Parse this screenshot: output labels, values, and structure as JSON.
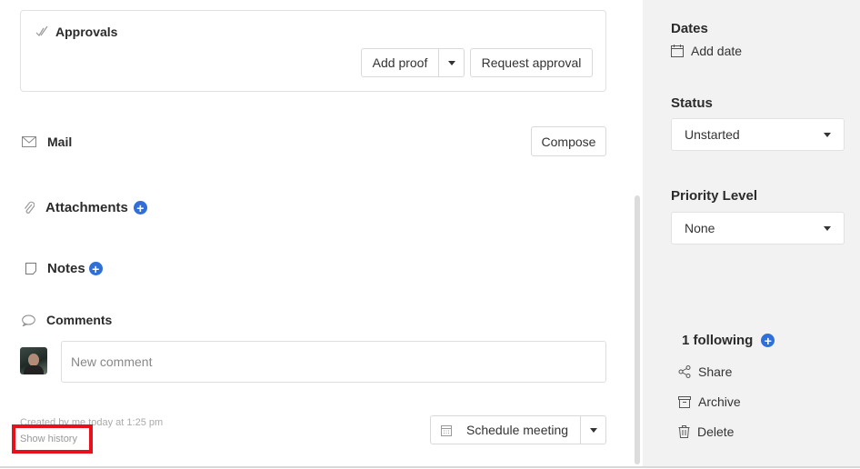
{
  "approvals": {
    "title": "Approvals",
    "add_proof": "Add proof",
    "request_approval": "Request approval"
  },
  "mail": {
    "title": "Mail",
    "compose": "Compose"
  },
  "attachments": {
    "title": "Attachments"
  },
  "notes": {
    "title": "Notes"
  },
  "comments": {
    "title": "Comments",
    "placeholder": "New comment"
  },
  "footer": {
    "created": "Created by me today at 1:25 pm",
    "show_history": "Show history",
    "schedule_meeting": "Schedule meeting"
  },
  "sidebar": {
    "dates_label": "Dates",
    "add_date": "Add date",
    "status_label": "Status",
    "status_value": "Unstarted",
    "priority_label": "Priority Level",
    "priority_value": "None",
    "following": "1 following",
    "share": "Share",
    "archive": "Archive",
    "delete": "Delete"
  },
  "colors": {
    "accent": "#2f6fd8",
    "highlight": "#e8101a",
    "sidebar_bg": "#f2f2f2"
  }
}
